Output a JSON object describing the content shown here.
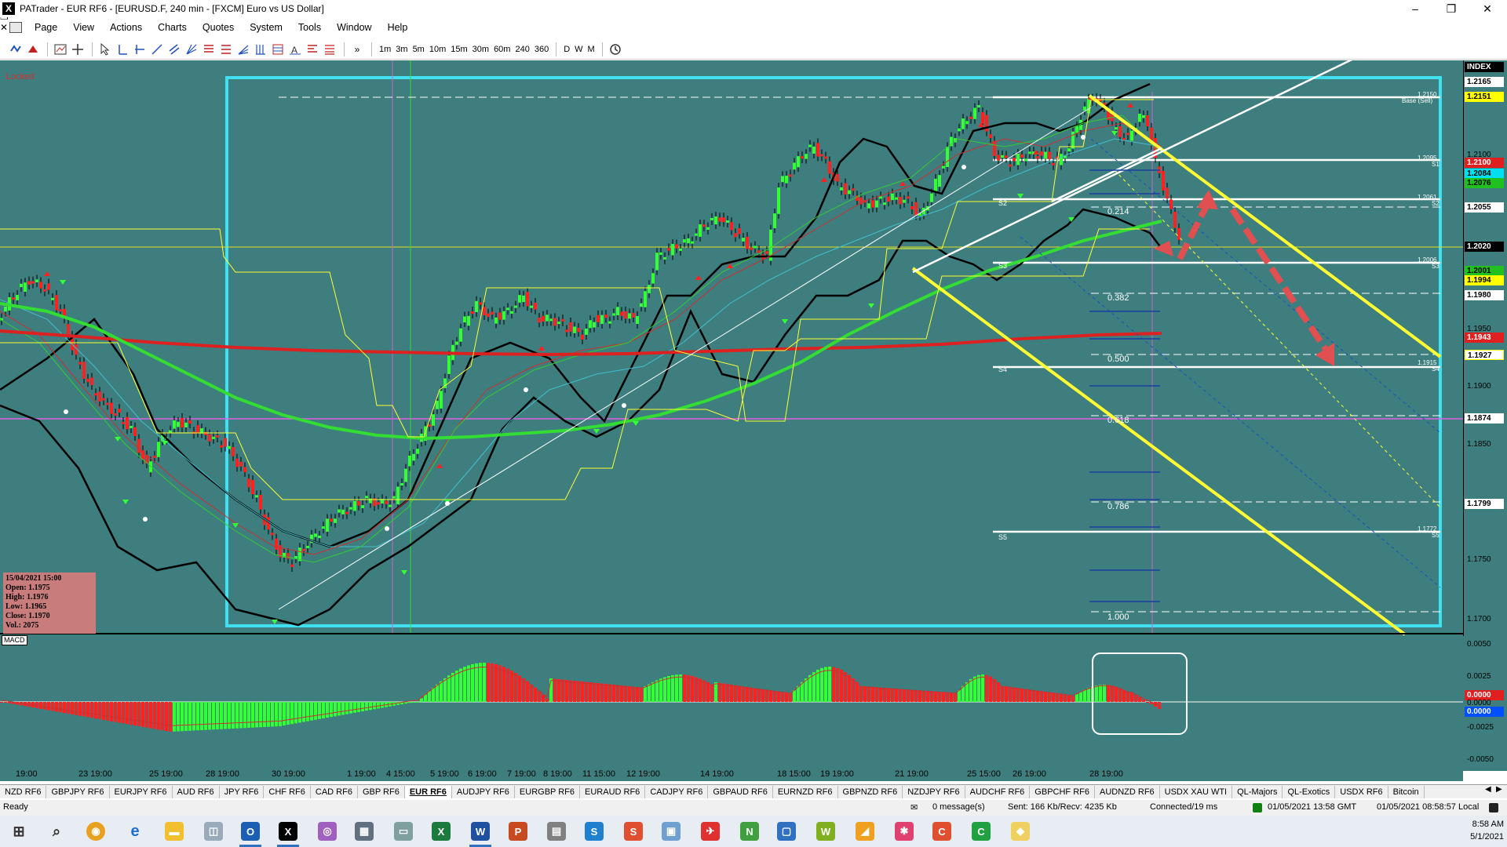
{
  "window": {
    "title": "PATrader - EUR RF6 - [EURUSD.F, 240 min - [FXCM] Euro vs US Dollar]",
    "minimize": "–",
    "restore": "❐",
    "close": "✕"
  },
  "menu": {
    "items": [
      "Page",
      "View",
      "Actions",
      "Charts",
      "Quotes",
      "System",
      "Tools",
      "Window",
      "Help"
    ]
  },
  "toolbar": {
    "timeframes": [
      "1m",
      "3m",
      "5m",
      "10m",
      "15m",
      "30m",
      "60m",
      "240",
      "360"
    ],
    "periods": [
      "D",
      "W",
      "M"
    ],
    "overflow": "»"
  },
  "chart": {
    "locked_label": "Locked",
    "macd_label": "MACD",
    "index_label": "INDEX",
    "info": {
      "date": "15/04/2021 15:00",
      "open": "Open: 1.1975",
      "high": "High: 1.1976",
      "low": "Low: 1.1965",
      "close": "Close: 1.1970",
      "vol": "Vol.: 2075"
    },
    "fib_levels": [
      "0.214",
      "0.382",
      "0.500",
      "0.618",
      "0.786",
      "1.000"
    ],
    "pivot_labels": [
      "S2",
      "S3",
      "S4",
      "S5"
    ],
    "right_tags": [
      "1.2150",
      "Base (Sell)",
      "1.2095",
      "S1",
      "1.2061",
      "S2",
      "1.2006",
      "S3",
      "1.1915",
      "S4",
      "1.1772",
      "S5"
    ],
    "price_ticks": [
      "1.2165",
      "1.2151",
      "1.2100",
      "1.2084",
      "1.2076",
      "1.2055",
      "1.2020",
      "1.2001",
      "1.1994",
      "1.1980",
      "1.1950",
      "1.1943",
      "1.1927",
      "1.1900",
      "1.1874",
      "1.1850",
      "1.1799",
      "1.1750",
      "1.1700"
    ],
    "macd_ticks": [
      "0.0050",
      "0.0025",
      "0.0000",
      "-0.0025",
      "-0.0050"
    ],
    "macd_values": [
      "0.0000",
      "0.0000"
    ],
    "time_labels": [
      "19:00",
      "23 19:00",
      "25 19:00",
      "28 19:00",
      "30 19:00",
      "1 19:00",
      "4 15:00",
      "5 19:00",
      "6 19:00",
      "7 19:00",
      "8 19:00",
      "11 15:00",
      "12 19:00",
      "14 19:00",
      "18 15:00",
      "19 19:00",
      "21 19:00",
      "25 15:00",
      "26 19:00",
      "28 19:00"
    ]
  },
  "tabs": {
    "items": [
      "NZD RF6",
      "GBPJPY RF6",
      "EURJPY RF6",
      "AUD RF6",
      "JPY RF6",
      "CHF RF6",
      "CAD RF6",
      "GBP RF6",
      "EUR RF6",
      "AUDJPY RF6",
      "EURGBP RF6",
      "EURAUD RF6",
      "CADJPY RF6",
      "GBPAUD RF6",
      "EURNZD RF6",
      "GBPNZD RF6",
      "NZDJPY RF6",
      "AUDCHF RF6",
      "GBPCHF RF6",
      "AUDNZD RF6",
      "USDX XAU WTI",
      "QL-Majors",
      "QL-Exotics",
      "USDX RF6",
      "Bitcoin"
    ],
    "active": "EUR RF6"
  },
  "status": {
    "ready": "Ready",
    "messages": "0 message(s)",
    "traffic": "Sent: 166 Kb/Recv: 4235 Kb",
    "connection": "Connected/19 ms",
    "gmt_time": "01/05/2021 13:58 GMT",
    "local_time": "01/05/2021 08:58:57 Local"
  },
  "clock": {
    "time": "8:58 AM",
    "date": "5/1/2021"
  },
  "colors": {
    "chart_bg": "#3e7e7e",
    "bull": "#33ff33",
    "bear": "#ff2020",
    "frame": "#40e0f0",
    "channel": "#ffff33",
    "ema_red": "#dd2020",
    "ema_green": "#33dd33"
  }
}
